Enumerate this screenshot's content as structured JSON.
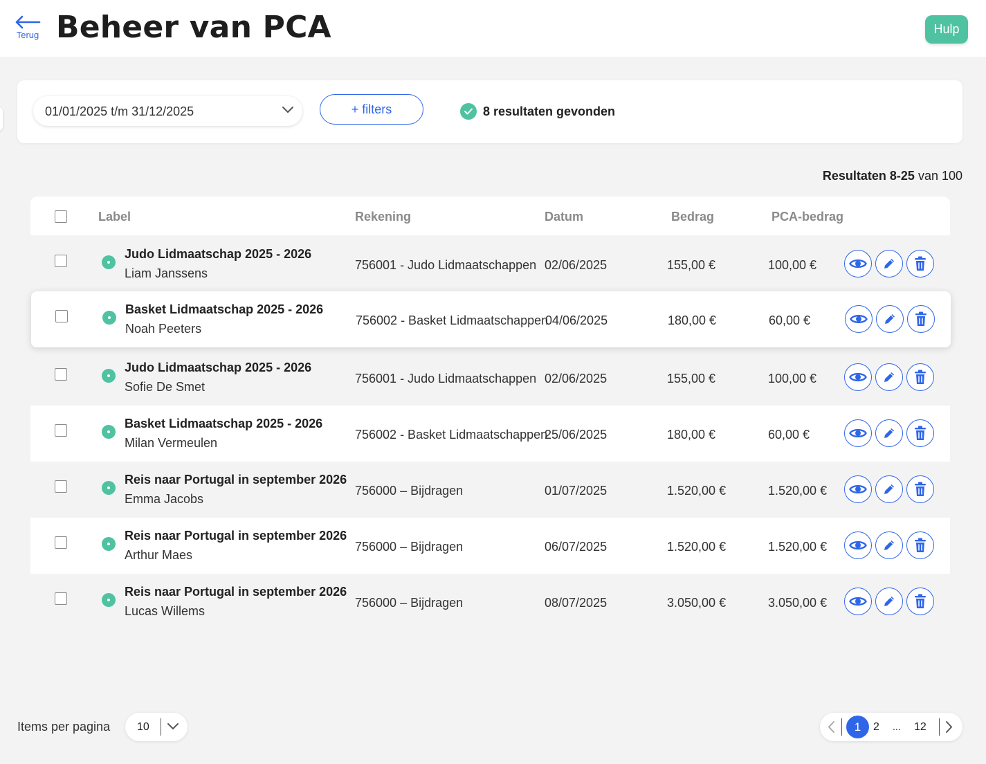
{
  "header": {
    "back_label": "Terug",
    "title": "Beheer van PCA",
    "help_label": "Hulp"
  },
  "filters": {
    "date_range": "01/01/2025 t/m 31/12/2025",
    "filters_button": "+ filters",
    "results_found": "8 resultaten gevonden"
  },
  "results_summary": {
    "range": "Resultaten 8-25",
    "total": "van 100"
  },
  "table": {
    "columns": {
      "label": "Label",
      "account": "Rekening",
      "date": "Datum",
      "amount": "Bedrag",
      "pca_amount": "PCA-bedrag"
    },
    "rows": [
      {
        "title": "Judo Lidmaatschap 2025 - 2026",
        "name": "Liam Janssens",
        "account": "756001 - Judo Lidmaatschappen",
        "date": "02/06/2025",
        "amount": "155,00 €",
        "pca_amount": "100,00 €"
      },
      {
        "title": "Basket Lidmaatschap 2025 - 2026",
        "name": "Noah Peeters",
        "account": "756002 - Basket Lidmaatschappen",
        "date": "04/06/2025",
        "amount": "180,00 €",
        "pca_amount": "60,00 €"
      },
      {
        "title": "Judo Lidmaatschap 2025 - 2026",
        "name": "Sofie De Smet",
        "account": "756001 - Judo Lidmaatschappen",
        "date": "02/06/2025",
        "amount": "155,00 €",
        "pca_amount": "100,00 €"
      },
      {
        "title": "Basket Lidmaatschap 2025 - 2026",
        "name": "Milan Vermeulen",
        "account": "756002 - Basket Lidmaatschappen",
        "date": "25/06/2025",
        "amount": "180,00 €",
        "pca_amount": "60,00 €"
      },
      {
        "title": "Reis naar Portugal in september 2026",
        "name": "Emma Jacobs",
        "account": "756000 – Bijdragen",
        "date": "01/07/2025",
        "amount": "1.520,00 €",
        "pca_amount": "1.520,00 €"
      },
      {
        "title": "Reis naar Portugal in september 2026",
        "name": "Arthur Maes",
        "account": "756000 – Bijdragen",
        "date": "06/07/2025",
        "amount": "1.520,00 €",
        "pca_amount": "1.520,00 €"
      },
      {
        "title": "Reis naar Portugal in september 2026",
        "name": "Lucas Willems",
        "account": "756000 – Bijdragen",
        "date": "08/07/2025",
        "amount": "3.050,00 €",
        "pca_amount": "3.050,00 €"
      }
    ]
  },
  "footer": {
    "items_per_page_label": "Items per pagina",
    "items_per_page_value": "10",
    "pages": {
      "current": "1",
      "next": "2",
      "ellipsis": "...",
      "last": "12"
    }
  },
  "colors": {
    "accent": "#2f66e8",
    "success": "#4fc2a1",
    "background": "#f3f3f3"
  },
  "icons": {
    "back": "arrow-left-icon",
    "dropdown": "chevron-down-icon",
    "status": "status-dot-icon",
    "view": "eye-icon",
    "edit": "pencil-icon",
    "delete": "trash-icon",
    "prev": "chevron-left-icon",
    "next": "chevron-right-icon"
  }
}
